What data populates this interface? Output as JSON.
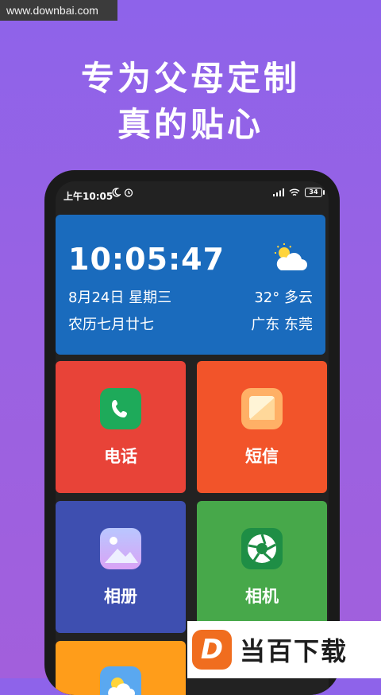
{
  "watermark": "www.downbai.com",
  "headline": {
    "line1": "专为父母定制",
    "line2": "真的贴心"
  },
  "statusbar": {
    "time": "上午10:05",
    "battery": "34"
  },
  "weather_card": {
    "time": "10:05:47",
    "date": "8月24日  星期三",
    "lunar": "农历七月廿七",
    "temp": "32°  多云",
    "location": "广东  东莞"
  },
  "tiles": [
    {
      "label": "电话",
      "color": "#e84338",
      "icon": "phone-icon"
    },
    {
      "label": "短信",
      "color": "#f2542a",
      "icon": "message-icon"
    },
    {
      "label": "相册",
      "color": "#3e4fb0",
      "icon": "gallery-icon"
    },
    {
      "label": "相机",
      "color": "#47a84a",
      "icon": "camera-icon"
    },
    {
      "label": "",
      "color": "#ff9d1a",
      "icon": "weather-icon"
    }
  ],
  "bottom_logo": {
    "mark": "D",
    "text": "当百下载"
  }
}
